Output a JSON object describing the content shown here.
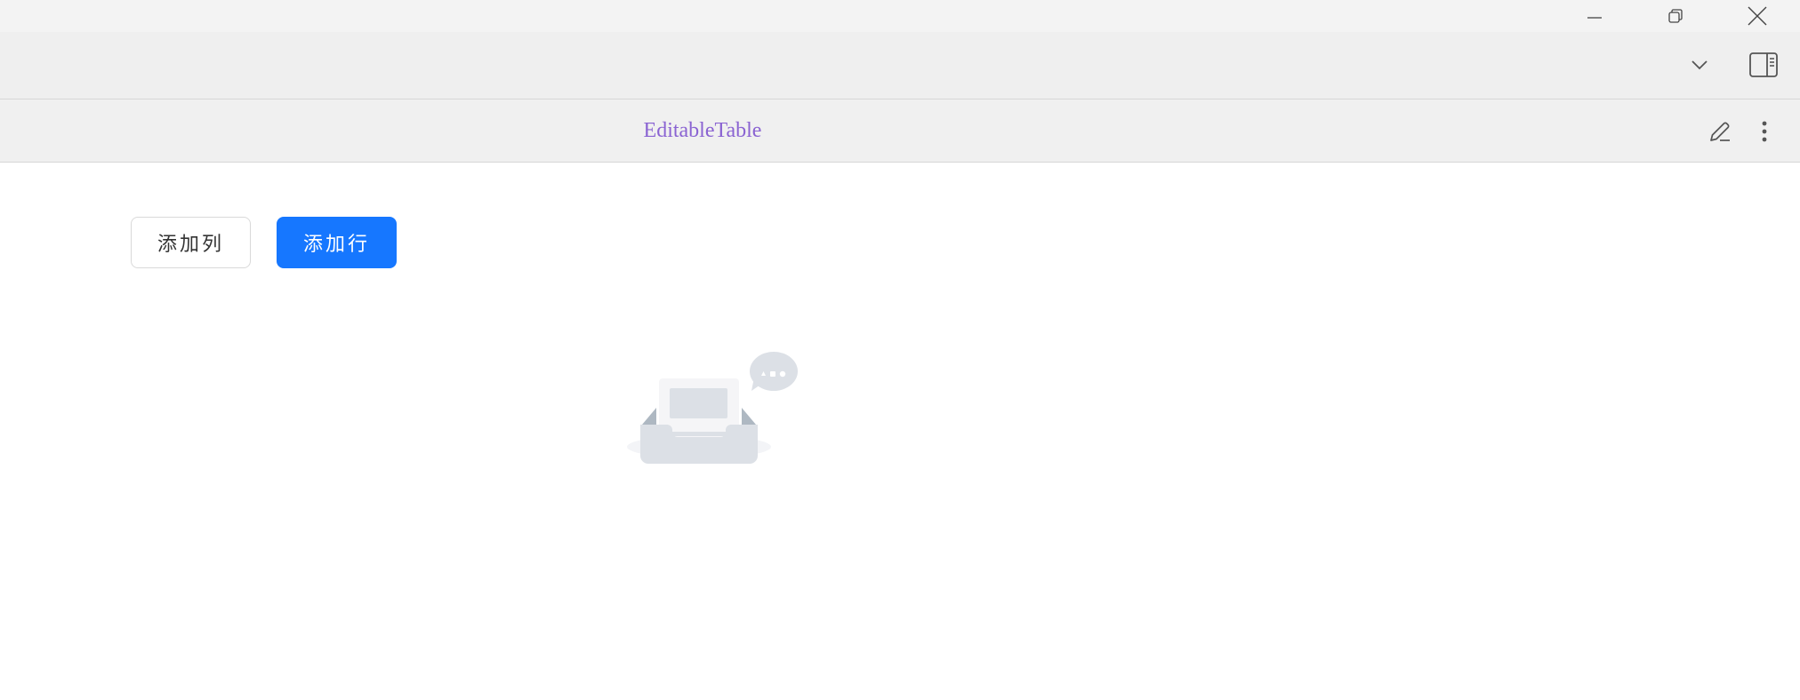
{
  "window": {
    "minimize_icon": "minimize-icon",
    "restore_icon": "restore-icon",
    "close_icon": "close-icon"
  },
  "toolbar": {
    "dropdown_icon": "chevron-down-icon",
    "sidebar_toggle_icon": "sidebar-toggle-icon"
  },
  "view": {
    "title": "EditableTable",
    "edit_icon": "pencil-icon",
    "more_icon": "more-vertical-icon"
  },
  "actions": {
    "add_column_label": "添加列",
    "add_row_label": "添加行"
  },
  "empty_state": {
    "illustration": "empty-inbox-icon"
  },
  "colors": {
    "title_accent": "#8a63d2",
    "primary": "#1677ff"
  }
}
